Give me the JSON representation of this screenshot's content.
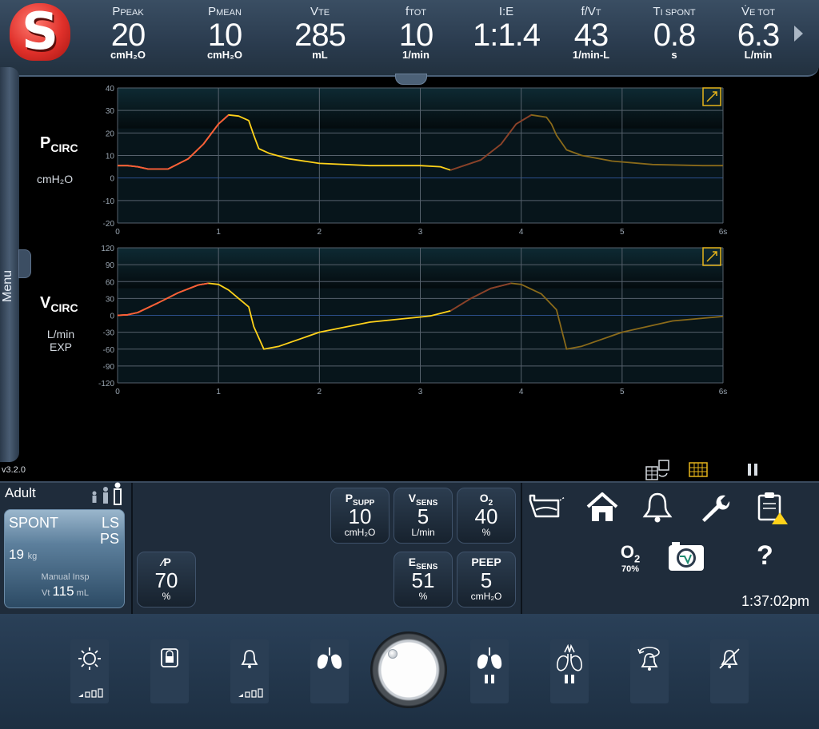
{
  "header": {
    "logo_letter": "S",
    "params": [
      {
        "label": "P",
        "sub": "PEAK",
        "value": "20",
        "unit": "cmH₂O"
      },
      {
        "label": "P",
        "sub": "MEAN",
        "value": "10",
        "unit": "cmH₂O"
      },
      {
        "label": "V",
        "sub": "TE",
        "value": "285",
        "unit": "mL"
      },
      {
        "label": "f",
        "sub": "TOT",
        "value": "10",
        "unit": "1/min"
      },
      {
        "label": "I:E",
        "sub": "",
        "value": "1:1.4",
        "unit": ""
      },
      {
        "label": "f/V",
        "sub": "T",
        "value": "43",
        "unit": "1/min-L"
      },
      {
        "label": "T",
        "sub": "I SPONT",
        "value": "0.8",
        "unit": "s"
      },
      {
        "label": "V̇",
        "sub": "E TOT",
        "value": "6.3",
        "unit": "L/min"
      }
    ]
  },
  "menu": {
    "label": "Menu",
    "version": "v3.2.0"
  },
  "waveforms": {
    "pressure": {
      "title_main": "P",
      "title_sub": "CIRC",
      "unit": "cmH₂O"
    },
    "flow": {
      "title_main": "V",
      "title_sub": "CIRC",
      "unit_line1": "L/min",
      "unit_line2": "EXP"
    }
  },
  "chart_data": [
    {
      "type": "line",
      "title": "PCIRC",
      "ylabel": "cmH2O",
      "xlabel": "",
      "xlim": [
        0,
        6
      ],
      "ylim": [
        -20,
        40
      ],
      "x_ticks": [
        "0",
        "1",
        "2",
        "3",
        "4",
        "5",
        "6s"
      ],
      "y_ticks": [
        "40",
        "30",
        "20",
        "10",
        "0",
        "-10",
        "-20"
      ],
      "grid": true,
      "series": [
        {
          "name": "",
          "color": "#ffd21a",
          "accent": "#ff5a3a",
          "x": [
            0,
            0.1,
            0.2,
            0.3,
            0.5,
            0.7,
            0.85,
            1.0,
            1.1,
            1.2,
            1.3,
            1.35,
            1.4,
            1.5,
            1.7,
            2.0,
            2.5,
            3.0,
            3.2,
            3.3
          ],
          "y": [
            5.5,
            5.5,
            5,
            4,
            4,
            8.5,
            15,
            24,
            28,
            27.5,
            25.5,
            19,
            13,
            11,
            8.5,
            6.5,
            5.5,
            5.5,
            5,
            3.5
          ]
        },
        {
          "name": "",
          "color": "#8a6a1a",
          "accent": "#8a3f2a",
          "x": [
            3.3,
            3.6,
            3.8,
            3.95,
            4.1,
            4.25,
            4.3,
            4.35,
            4.45,
            4.6,
            4.9,
            5.3,
            5.8,
            6.0
          ],
          "y": [
            3.5,
            8,
            15,
            24,
            28,
            27,
            24,
            19,
            12.5,
            10,
            7.5,
            6,
            5.5,
            5.5
          ]
        }
      ]
    },
    {
      "type": "line",
      "title": "VCIRC",
      "ylabel": "L/min EXP",
      "xlabel": "",
      "xlim": [
        0,
        6
      ],
      "ylim": [
        -120,
        120
      ],
      "x_ticks": [
        "0",
        "1",
        "2",
        "3",
        "4",
        "5",
        "6s"
      ],
      "y_ticks": [
        "120",
        "90",
        "60",
        "30",
        "0",
        "-30",
        "-60",
        "-90",
        "-120"
      ],
      "grid": true,
      "series": [
        {
          "name": "",
          "color": "#ffd21a",
          "accent": "#ff5a3a",
          "x": [
            0,
            0.1,
            0.2,
            0.4,
            0.6,
            0.8,
            0.9,
            1.0,
            1.1,
            1.2,
            1.3,
            1.35,
            1.45,
            1.6,
            2.0,
            2.5,
            3.0,
            3.1,
            3.3
          ],
          "y": [
            0,
            1,
            5,
            22,
            40,
            54,
            57,
            55,
            45,
            30,
            15,
            -20,
            -60,
            -55,
            -30,
            -12,
            -3,
            -1,
            8
          ]
        },
        {
          "name": "",
          "color": "#8a6a1a",
          "accent": "#8a3f2a",
          "x": [
            3.3,
            3.5,
            3.7,
            3.9,
            4.0,
            4.2,
            4.35,
            4.45,
            4.6,
            5.0,
            5.5,
            6.0
          ],
          "y": [
            8,
            30,
            48,
            57,
            55,
            38,
            10,
            -60,
            -55,
            -30,
            -10,
            -2
          ]
        }
      ]
    }
  ],
  "patient": {
    "category": "Adult",
    "mode": "SPONT",
    "mode_sub1": "LS",
    "mode_sub2": "PS",
    "weight": "19",
    "weight_unit": "kg",
    "manual_label": "Manual Insp",
    "vt_label": "Vt",
    "vt_value": "115",
    "vt_unit": "mL"
  },
  "settings": [
    {
      "id": "psupp",
      "label": "P",
      "sub": "SUPP",
      "value": "10",
      "unit": "cmH₂O"
    },
    {
      "id": "vsens",
      "label": "V",
      "sub": "SENS",
      "value": "5",
      "unit": "L/min"
    },
    {
      "id": "o2",
      "label": "O",
      "sub": "2",
      "value": "40",
      "unit": "%"
    },
    {
      "id": "rise",
      "label": "∕P",
      "sub": "",
      "value": "70",
      "unit": "%"
    },
    {
      "id": "esens",
      "label": "E",
      "sub": "SENS",
      "value": "51",
      "unit": "%"
    },
    {
      "id": "peep",
      "label": "PEEP",
      "sub": "",
      "value": "5",
      "unit": "cmH₂O"
    }
  ],
  "status": {
    "o2_label": "O",
    "o2_sub": "2",
    "o2_pct": "70%",
    "help": "?",
    "time": "1:37:02pm"
  },
  "icons": {
    "top": [
      "breath-trace-icon",
      "home-icon",
      "alarm-bell-icon",
      "wrench-icon",
      "clipboard-alert-icon"
    ],
    "bottom": [
      "brightness-icon",
      "screen-lock-icon",
      "alarm-volume-icon",
      "manual-breath-icon",
      "insp-pause-icon",
      "exp-pause-icon",
      "alarm-reset-icon",
      "audio-paused-icon"
    ]
  },
  "colors": {
    "accent_yellow": "#ffd21a",
    "accent_orange": "#ff5a3a",
    "bg_panel": "#1f2c3b",
    "logo_red": "#e0302a"
  }
}
